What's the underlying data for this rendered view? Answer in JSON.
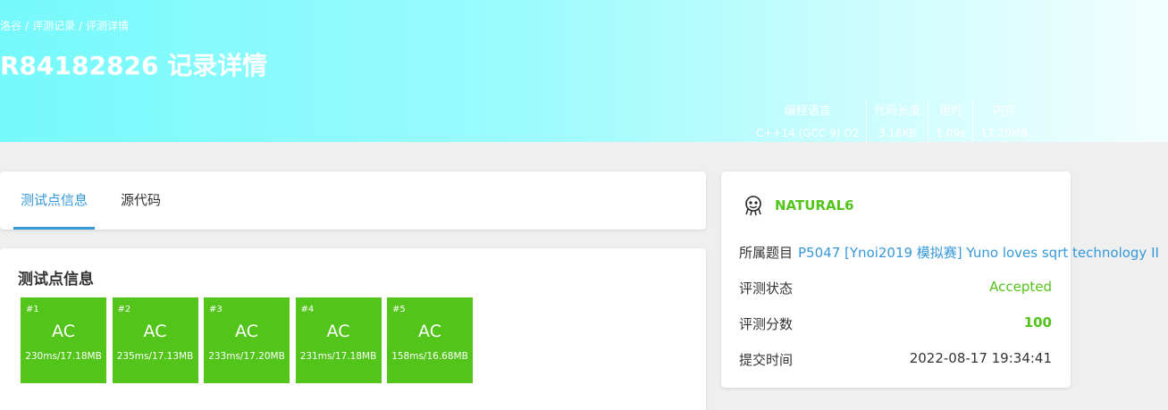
{
  "header": {
    "breadcrumb": [
      "洛谷",
      "评测记录",
      "评测详情"
    ],
    "title": "R84182826 记录详情",
    "stats": [
      {
        "label": "编程语言",
        "value": "C++14 (GCC 9) O2"
      },
      {
        "label": "代码长度",
        "value": "3.16KB"
      },
      {
        "label": "用时",
        "value": "1.09s"
      },
      {
        "label": "内存",
        "value": "17.20MB"
      }
    ]
  },
  "tabs": [
    {
      "label": "测试点信息",
      "active": true
    },
    {
      "label": "源代码",
      "active": false
    }
  ],
  "testcases": {
    "title": "测试点信息",
    "cases": [
      {
        "num": "#1",
        "result": "AC",
        "detail": "230ms/17.18MB"
      },
      {
        "num": "#2",
        "result": "AC",
        "detail": "235ms/17.13MB"
      },
      {
        "num": "#3",
        "result": "AC",
        "detail": "233ms/17.20MB"
      },
      {
        "num": "#4",
        "result": "AC",
        "detail": "231ms/17.18MB"
      },
      {
        "num": "#5",
        "result": "AC",
        "detail": "158ms/16.68MB"
      }
    ]
  },
  "info": {
    "username": "NATURAL6",
    "problem_label": "所属题目",
    "problem_value": "P5047 [Ynoi2019 模拟赛] Yuno loves sqrt technology II",
    "status_label": "评测状态",
    "status_value": "Accepted",
    "score_label": "评测分数",
    "score_value": "100",
    "time_label": "提交时间",
    "time_value": "2022-08-17 19:34:41"
  },
  "colors": {
    "accent": "#3498db",
    "ac_green": "#52c41a",
    "header_gradient_start": "#76f9fb"
  }
}
